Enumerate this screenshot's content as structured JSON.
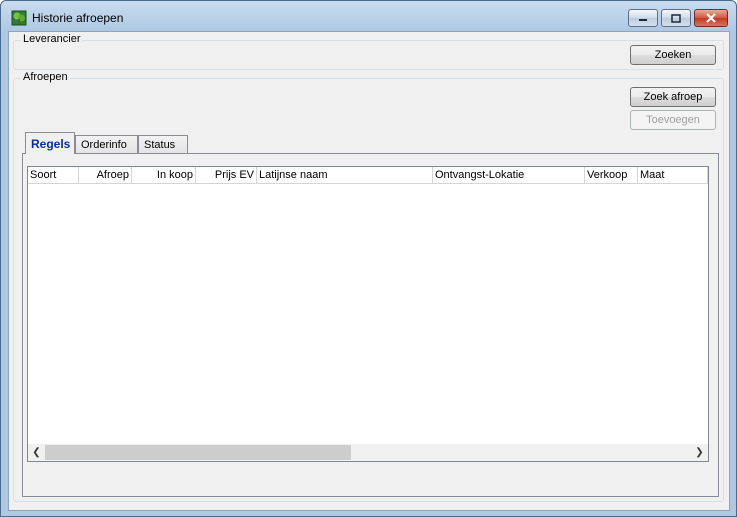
{
  "window": {
    "title": "Historie afroepen",
    "controls": [
      "minimize",
      "maximize",
      "close"
    ]
  },
  "leverancier": {
    "legend": "Leverancier",
    "search_button": "Zoeken"
  },
  "afroepen": {
    "legend": "Afroepen",
    "search_button": "Zoek afroep",
    "add_button": "Toevoegen"
  },
  "tabs": [
    {
      "label": "Regels",
      "active": true
    },
    {
      "label": "Orderinfo",
      "active": false
    },
    {
      "label": "Status",
      "active": false
    }
  ],
  "table": {
    "columns": [
      "Soort",
      "Afroep",
      "In koop",
      "Prijs EV",
      "Latijnse naam",
      "Ontvangst-Lokatie",
      "Verkoop",
      "Maat"
    ],
    "rows": []
  },
  "icons": {
    "app": "tree-icon",
    "scroll_left": "scroll-left-icon",
    "scroll_right": "scroll-right-icon"
  }
}
